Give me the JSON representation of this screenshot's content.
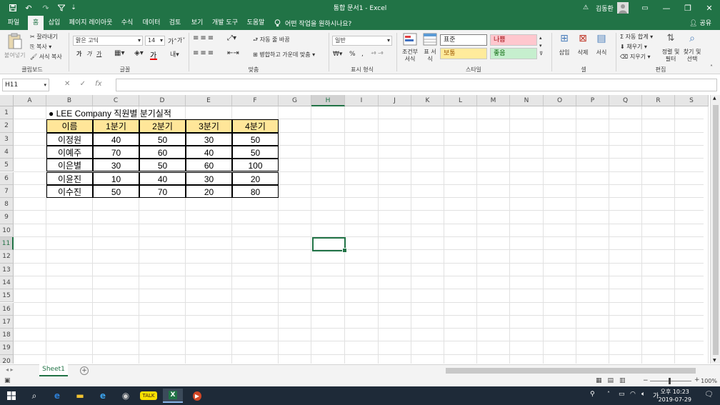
{
  "app": {
    "title": "통합 문서1  -  Excel",
    "user": "김동환",
    "quick_access": {
      "save_icon": "save-icon",
      "undo_icon": "undo-icon",
      "redo_icon": "redo-icon",
      "customize_icon": "customize-icon"
    },
    "window_buttons": {
      "minimize": "—",
      "restore": "❐",
      "close": "✕"
    },
    "warn_icon": "⚠",
    "ribbon_display": "▭"
  },
  "tabs": [
    {
      "label": "파일"
    },
    {
      "label": "홈"
    },
    {
      "label": "삽입"
    },
    {
      "label": "페이지 레이아웃"
    },
    {
      "label": "수식"
    },
    {
      "label": "데이터"
    },
    {
      "label": "검토"
    },
    {
      "label": "보기"
    },
    {
      "label": "개발 도구"
    },
    {
      "label": "도움말"
    }
  ],
  "tell_me": "어떤 작업을 원하시나요?",
  "share": "공유",
  "ribbon": {
    "clipboard": {
      "paste": "붙여넣기",
      "cut": "잘라내기",
      "copy": "복사",
      "format_painter": "서식 복사",
      "label": "클립보드"
    },
    "font": {
      "name": "맑은 고딕",
      "size": "14",
      "grow": "가",
      "shrink": "가",
      "bold": "가",
      "italic": "가",
      "underline": "가",
      "label": "글꼴"
    },
    "alignment": {
      "wrap": "자동 줄 바꿈",
      "merge": "병합하고 가운데 맞춤",
      "label": "맞춤"
    },
    "number": {
      "format": "일반",
      "percent": "%",
      "comma": ",",
      "label": "표시 형식"
    },
    "styles": {
      "conditional": "조건부 서식",
      "table": "표 서식",
      "normal": "표준",
      "bad": "나쁨",
      "neutral": "보통",
      "good": "좋음",
      "label": "스타일"
    },
    "cells": {
      "insert": "삽입",
      "delete": "삭제",
      "format": "서식",
      "label": "셀"
    },
    "editing": {
      "autosum": "자동 합계",
      "fill": "채우기",
      "clear": "지우기",
      "sort": "정렬 및 필터",
      "find": "찾기 및 선택",
      "label": "편집"
    }
  },
  "formula_bar": {
    "name_box": "H11",
    "cancel": "✕",
    "enter": "✓",
    "fx": "fx",
    "value": ""
  },
  "columns": [
    "A",
    "B",
    "C",
    "D",
    "E",
    "F",
    "G",
    "H",
    "I",
    "J",
    "K",
    "L",
    "M",
    "N",
    "O",
    "P",
    "Q",
    "R",
    "S"
  ],
  "rows": [
    "1",
    "2",
    "3",
    "4",
    "5",
    "6",
    "7",
    "8",
    "9",
    "10",
    "11",
    "12",
    "13",
    "14",
    "15",
    "16",
    "17",
    "18",
    "19",
    "20"
  ],
  "selected": {
    "column": "H",
    "row": "11"
  },
  "sheet": {
    "title": "● LEE Company 직원별 분기실적",
    "headers": [
      "이름",
      "1분기",
      "2분기",
      "3분기",
      "4분기"
    ],
    "data": [
      [
        "이정원",
        "40",
        "50",
        "30",
        "50"
      ],
      [
        "이예주",
        "70",
        "60",
        "40",
        "50"
      ],
      [
        "이은별",
        "30",
        "50",
        "60",
        "100"
      ],
      [
        "이윤진",
        "10",
        "40",
        "30",
        "20"
      ],
      [
        "이수진",
        "50",
        "70",
        "20",
        "80"
      ]
    ],
    "header_fill": "#ffe699"
  },
  "sheet_tabs": [
    {
      "label": "Sheet1"
    }
  ],
  "status": {
    "zoom": "100%"
  },
  "taskbar": {
    "time": "오후 10:23",
    "date": "2019-07-29",
    "ime": "가"
  },
  "colors": {
    "accent": "#217346"
  }
}
